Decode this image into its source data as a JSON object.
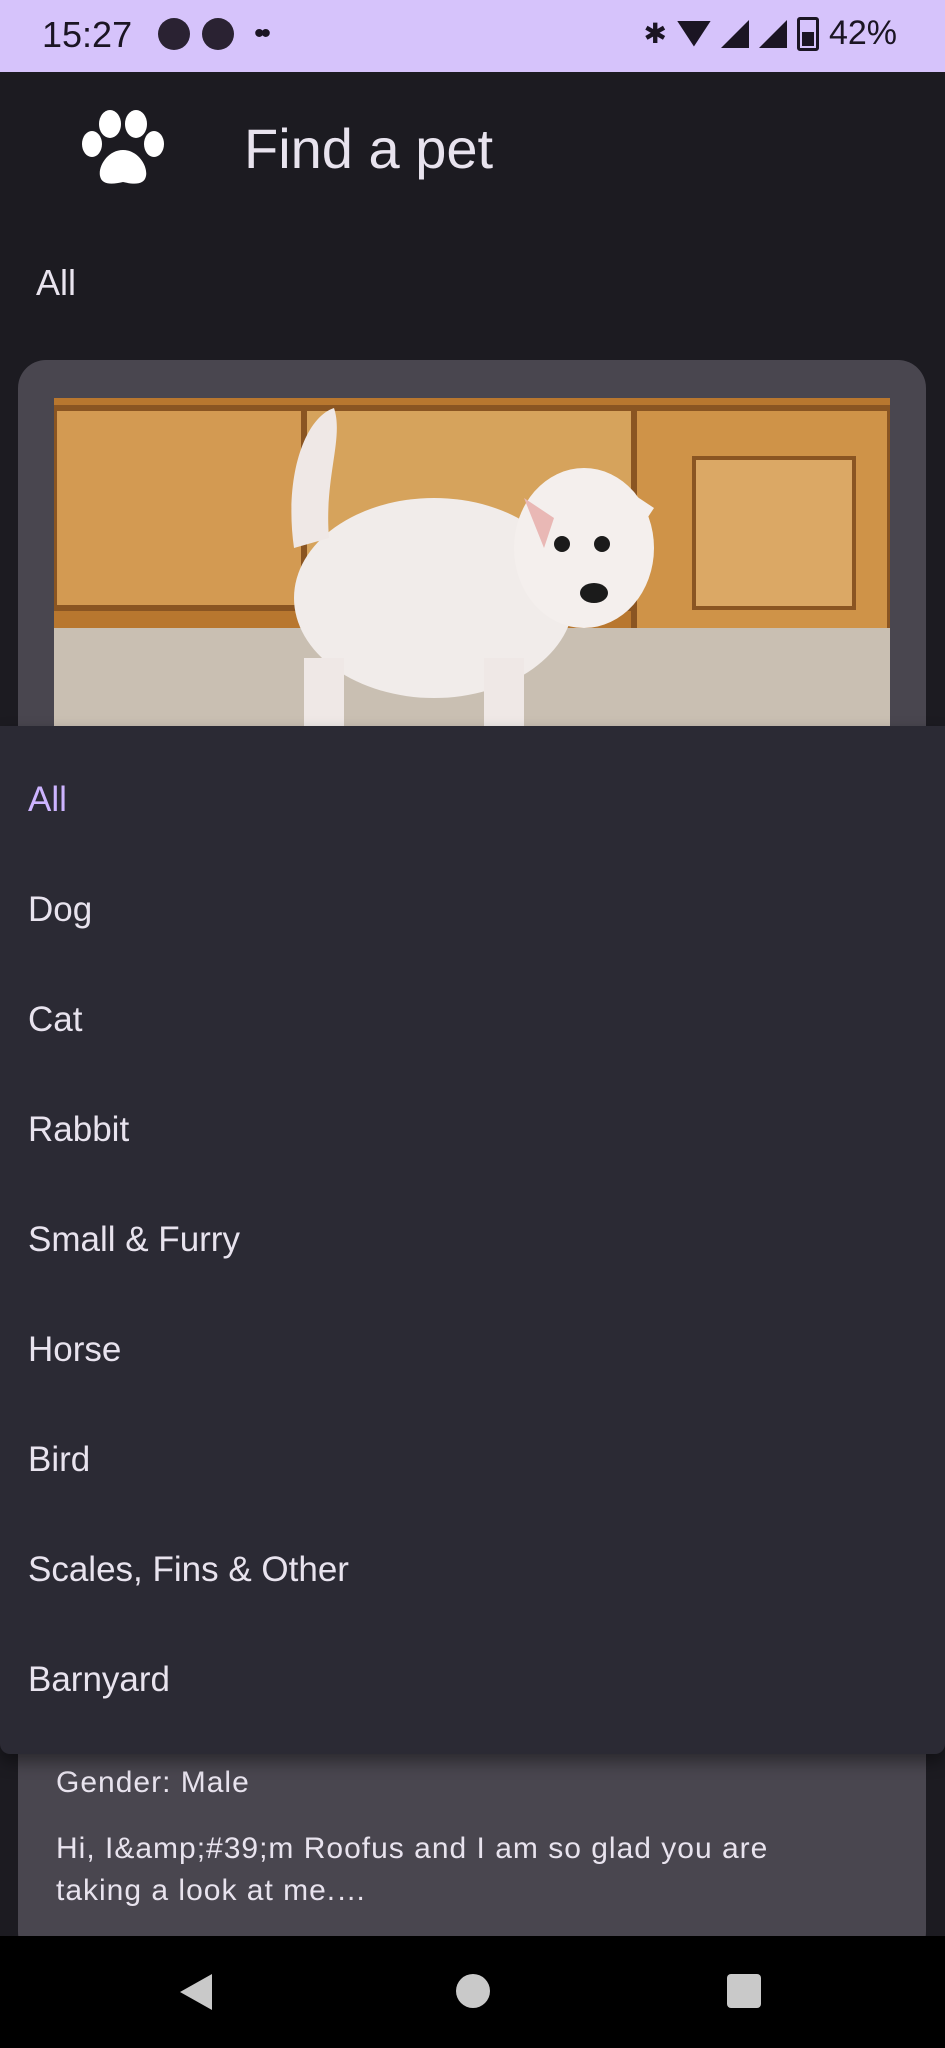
{
  "status_bar": {
    "time": "15:27",
    "battery": "42%",
    "icons": [
      "photo-app-icon",
      "messenger-icon",
      "more-notifications-icon",
      "bluetooth-icon",
      "wifi-icon",
      "signal-icon",
      "battery-icon"
    ]
  },
  "header": {
    "logo_icon": "paw-icon",
    "title": "Find a pet"
  },
  "filter": {
    "selected": "All"
  },
  "dropdown": {
    "options": [
      {
        "label": "All",
        "selected": true
      },
      {
        "label": "Dog"
      },
      {
        "label": "Cat"
      },
      {
        "label": "Rabbit"
      },
      {
        "label": "Small & Furry"
      },
      {
        "label": "Horse"
      },
      {
        "label": "Bird"
      },
      {
        "label": "Scales, Fins & Other"
      },
      {
        "label": "Barnyard"
      }
    ]
  },
  "pet_card": {
    "gender": "Gender: Male",
    "description": "Hi, I&amp;#39;m Roofus and I am so glad you are taking a look at me.…"
  },
  "colors": {
    "status_bar": "#d6c3fb",
    "background": "#1c1b21",
    "card": "#49464f",
    "menu": "#2b2a34",
    "accent": "#cdb4ff"
  },
  "nav_bar": {
    "icons": [
      "back-icon",
      "home-icon",
      "recents-icon"
    ]
  }
}
